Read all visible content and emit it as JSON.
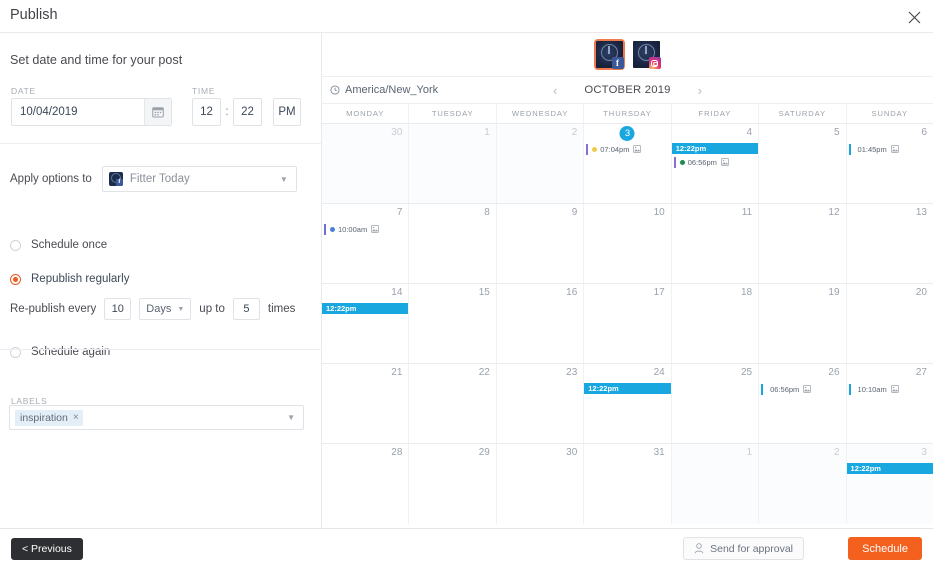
{
  "window": {
    "title": "Publish",
    "close_icon": "close-icon"
  },
  "left": {
    "section_title": "Set date and time for your post",
    "date_label": "DATE",
    "time_label": "TIME",
    "date_value": "10/04/2019",
    "date_picker_icon": "calendar-icon",
    "time_hour": "12",
    "time_separator": ":",
    "time_minute": "22",
    "time_meridiem": "PM",
    "apply_label": "Apply options to",
    "apply_account": "Fitter Today",
    "apply_account_icon": "facebook-avatar-icon",
    "options": [
      {
        "label": "Schedule once",
        "selected": false
      },
      {
        "label": "Republish regularly",
        "selected": true
      },
      {
        "label": "Schedule again",
        "selected": false
      }
    ],
    "republish": {
      "prefix": "Re-publish every",
      "interval": "10",
      "unit": "Days",
      "middle": "up to",
      "times": "5",
      "suffix": "times"
    },
    "labels_label": "LABELS",
    "label_chips": [
      {
        "text": "inspiration",
        "remove": "×"
      }
    ]
  },
  "calendar": {
    "accounts": [
      {
        "network": "facebook",
        "badge": "f",
        "selected": true
      },
      {
        "network": "instagram",
        "badge": "",
        "selected": false
      }
    ],
    "timezone": "America/New_York",
    "timezone_icon": "clock-icon",
    "prev_icon": "‹",
    "next_icon": "›",
    "month": "OCTOBER 2019",
    "day_headers": [
      "MONDAY",
      "TUESDAY",
      "WEDNESDAY",
      "THURSDAY",
      "FRIDAY",
      "SATURDAY",
      "SUNDAY"
    ],
    "weeks": [
      [
        {
          "day": "30",
          "out": true,
          "today": false,
          "events": []
        },
        {
          "day": "1",
          "out": true,
          "today": false,
          "events": []
        },
        {
          "day": "2",
          "out": true,
          "today": false,
          "events": []
        },
        {
          "day": "3",
          "out": false,
          "today": true,
          "events": [
            {
              "time": "07:04pm",
              "style": "plain",
              "bar": "#8b6fd1",
              "dot": "#f2c94c",
              "icon": "image-icon"
            }
          ]
        },
        {
          "day": "4",
          "out": false,
          "today": false,
          "events": [
            {
              "time": "12:22pm",
              "style": "filled"
            },
            {
              "time": "06:56pm",
              "style": "plain",
              "bar": "#8b6fd1",
              "dot": "#1f8a4c",
              "icon": "image-icon"
            }
          ]
        },
        {
          "day": "5",
          "out": false,
          "today": false,
          "events": []
        },
        {
          "day": "6",
          "out": false,
          "today": false,
          "events": [
            {
              "time": "01:45pm",
              "style": "plain",
              "bar": "#19a7e0",
              "dot": null,
              "icon": "image-icon"
            }
          ]
        }
      ],
      [
        {
          "day": "7",
          "out": false,
          "today": false,
          "events": [
            {
              "time": "10:00am",
              "style": "plain",
              "bar": "#6f6fd1",
              "dot": "#4a7fd4",
              "icon": "image-icon"
            }
          ]
        },
        {
          "day": "8",
          "out": false,
          "today": false,
          "events": []
        },
        {
          "day": "9",
          "out": false,
          "today": false,
          "events": []
        },
        {
          "day": "10",
          "out": false,
          "today": false,
          "events": []
        },
        {
          "day": "11",
          "out": false,
          "today": false,
          "events": []
        },
        {
          "day": "12",
          "out": false,
          "today": false,
          "events": []
        },
        {
          "day": "13",
          "out": false,
          "today": false,
          "events": []
        }
      ],
      [
        {
          "day": "14",
          "out": false,
          "today": false,
          "events": [
            {
              "time": "12:22pm",
              "style": "filled"
            }
          ]
        },
        {
          "day": "15",
          "out": false,
          "today": false,
          "events": []
        },
        {
          "day": "16",
          "out": false,
          "today": false,
          "events": []
        },
        {
          "day": "17",
          "out": false,
          "today": false,
          "events": []
        },
        {
          "day": "18",
          "out": false,
          "today": false,
          "events": []
        },
        {
          "day": "19",
          "out": false,
          "today": false,
          "events": []
        },
        {
          "day": "20",
          "out": false,
          "today": false,
          "events": []
        }
      ],
      [
        {
          "day": "21",
          "out": false,
          "today": false,
          "events": []
        },
        {
          "day": "22",
          "out": false,
          "today": false,
          "events": []
        },
        {
          "day": "23",
          "out": false,
          "today": false,
          "events": []
        },
        {
          "day": "24",
          "out": false,
          "today": false,
          "events": [
            {
              "time": "12:22pm",
              "style": "filled"
            }
          ]
        },
        {
          "day": "25",
          "out": false,
          "today": false,
          "events": []
        },
        {
          "day": "26",
          "out": false,
          "today": false,
          "events": [
            {
              "time": "06:56pm",
              "style": "plain",
              "bar": "#19a7e0",
              "dot": null,
              "icon": "image-icon"
            }
          ]
        },
        {
          "day": "27",
          "out": false,
          "today": false,
          "events": [
            {
              "time": "10:10am",
              "style": "plain",
              "bar": "#19a7e0",
              "dot": null,
              "icon": "image-icon"
            }
          ]
        }
      ],
      [
        {
          "day": "28",
          "out": false,
          "today": false,
          "events": []
        },
        {
          "day": "29",
          "out": false,
          "today": false,
          "events": []
        },
        {
          "day": "30",
          "out": false,
          "today": false,
          "events": []
        },
        {
          "day": "31",
          "out": false,
          "today": false,
          "events": []
        },
        {
          "day": "1",
          "out": true,
          "today": false,
          "events": []
        },
        {
          "day": "2",
          "out": true,
          "today": false,
          "events": []
        },
        {
          "day": "3",
          "out": true,
          "today": false,
          "events": [
            {
              "time": "12:22pm",
              "style": "filled"
            }
          ]
        }
      ]
    ]
  },
  "footer": {
    "previous": "< Previous",
    "send_for_approval": "Send for approval",
    "approval_icon": "person-icon",
    "schedule": "Schedule"
  },
  "colors": {
    "accent_orange": "#f4601e",
    "radio_orange": "#ef5a21",
    "event_blue": "#19a7e0",
    "dark_button": "#2e2f33"
  }
}
